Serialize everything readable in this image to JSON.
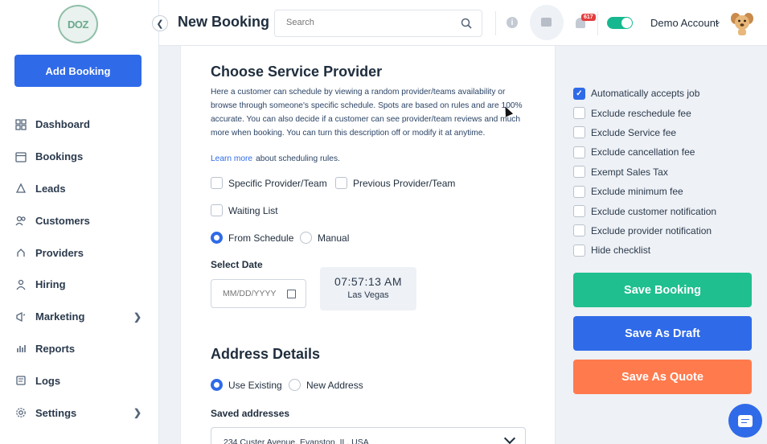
{
  "sidebar": {
    "logo_text": "DOZ",
    "add_booking_label": "Add Booking",
    "items": [
      {
        "label": "Dashboard",
        "icon": "dashboard-icon"
      },
      {
        "label": "Bookings",
        "icon": "calendar-icon"
      },
      {
        "label": "Leads",
        "icon": "leads-icon"
      },
      {
        "label": "Customers",
        "icon": "customers-icon"
      },
      {
        "label": "Providers",
        "icon": "providers-icon"
      },
      {
        "label": "Hiring",
        "icon": "hiring-icon"
      },
      {
        "label": "Marketing",
        "icon": "marketing-icon",
        "has_submenu": true
      },
      {
        "label": "Reports",
        "icon": "reports-icon"
      },
      {
        "label": "Logs",
        "icon": "logs-icon"
      },
      {
        "label": "Settings",
        "icon": "settings-icon",
        "has_submenu": true
      }
    ]
  },
  "header": {
    "title": "New Booking",
    "search_placeholder": "Search",
    "notification_count": "617",
    "toggle_on": true,
    "account_name": "Demo Account",
    "colors": {
      "toggle": "#17b890",
      "badge": "#e53c3c"
    }
  },
  "provider": {
    "title": "Choose Service Provider",
    "description": "Here a customer can schedule by viewing a random provider/teams availability or browse through someone's specific schedule. Spots are based on rules and are 100% accurate. You can also decide if a customer can see provider/team reviews and much more when booking. You can turn this description off or modify it at anytime.",
    "learn_more": "Learn more",
    "learn_more_suffix": "about scheduling rules.",
    "checkboxes": {
      "specific": "Specific Provider/Team",
      "previous": "Previous Provider/Team",
      "waiting": "Waiting List"
    },
    "schedule_options": {
      "from_schedule": "From Schedule",
      "manual": "Manual",
      "selected": "From Schedule"
    },
    "select_date_label": "Select Date",
    "date_placeholder": "MM/DD/YYYY",
    "clock_time": "07:57:13 AM",
    "clock_city": "Las Vegas"
  },
  "address": {
    "title": "Address Details",
    "options": {
      "existing": "Use Existing",
      "new": "New Address",
      "selected": "Use Existing"
    },
    "saved_label": "Saved addresses",
    "saved_value": "234 Custer Avenue, Evanston, IL, USA"
  },
  "options": [
    {
      "label": "Automatically accepts job",
      "checked": true
    },
    {
      "label": "Exclude reschedule fee",
      "checked": false
    },
    {
      "label": "Exclude Service fee",
      "checked": false
    },
    {
      "label": "Exclude cancellation fee",
      "checked": false
    },
    {
      "label": "Exempt Sales Tax",
      "checked": false
    },
    {
      "label": "Exclude minimum fee",
      "checked": false
    },
    {
      "label": "Exclude customer notification",
      "checked": false
    },
    {
      "label": "Exclude provider notification",
      "checked": false
    },
    {
      "label": "Hide checklist",
      "checked": false
    }
  ],
  "actions": {
    "save_booking": "Save Booking",
    "save_draft": "Save As Draft",
    "save_quote": "Save As Quote",
    "colors": {
      "save_booking": "#1fbf8f",
      "save_draft": "#2f6ae8",
      "save_quote": "#ff7a4d"
    }
  }
}
